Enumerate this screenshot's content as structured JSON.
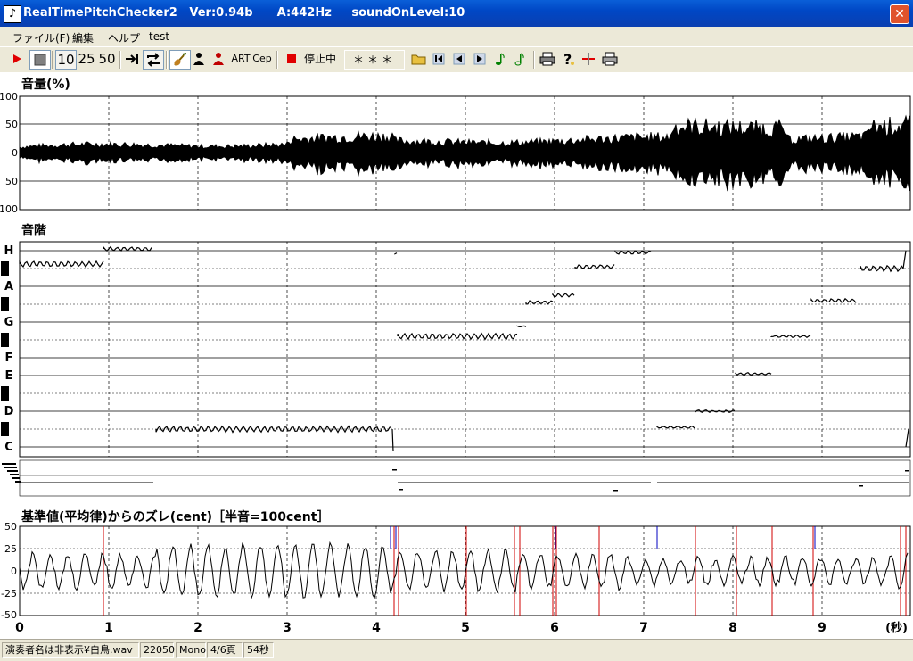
{
  "window": {
    "title": "RealTimePitchChecker2   Ver:0.94b      A:442Hz     soundOnLevel:10",
    "close_glyph": "✕"
  },
  "menu": [
    "ファイル(F)",
    "編集",
    "ヘルプ",
    "test"
  ],
  "toolbar": {
    "speed_buttons": [
      "10",
      "25",
      "50"
    ],
    "art_label": "ART",
    "cep_label": "Cep",
    "stop_status": "停止中",
    "display_field": "＊＊＊"
  },
  "volume_panel": {
    "title": "音量(%)",
    "y_labels": [
      "100",
      "50",
      "0",
      "50",
      "100"
    ]
  },
  "scale_panel": {
    "title": "音階",
    "notes": [
      "H",
      "A",
      "G",
      "F",
      "E",
      "D",
      "C"
    ]
  },
  "cent_panel": {
    "title": "基準値(平均律)からのズレ(cent)［半音=100cent］",
    "y_labels": [
      "50",
      "25",
      "0",
      "-25",
      "-50"
    ]
  },
  "time_axis": {
    "ticks": [
      "0",
      "1",
      "2",
      "3",
      "4",
      "5",
      "6",
      "7",
      "8",
      "9"
    ],
    "unit": "(秒)"
  },
  "statusbar": [
    "演奏者名は非表示¥白鳥.wav",
    "22050",
    "Mono",
    "4/6頁",
    "54秒"
  ],
  "colors": {
    "titlebar": "#0047c5",
    "record_red": "#e00000",
    "cent_red": "#d00000",
    "cent_blue": "#0000c0",
    "note_green": "#008000"
  }
}
